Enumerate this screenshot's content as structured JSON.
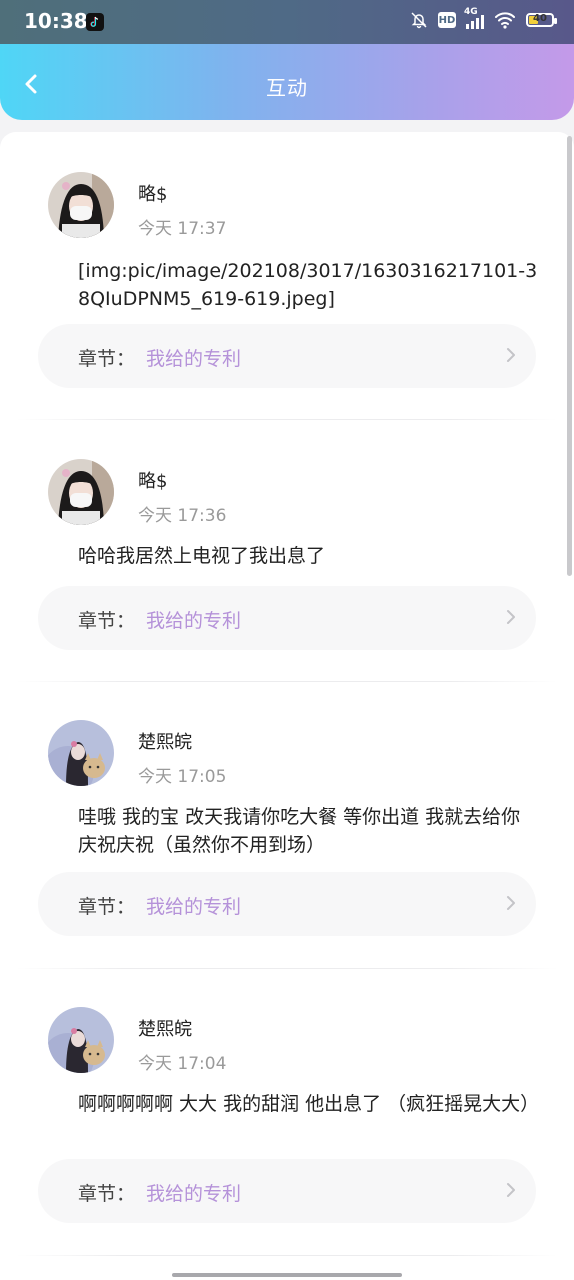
{
  "status_bar": {
    "time": "10:38",
    "network": "4G",
    "hd": "HD",
    "battery": "40",
    "battery_level": 0.4
  },
  "nav": {
    "title": "互动"
  },
  "items": [
    {
      "username": "略$",
      "time": "今天 17:37",
      "comment": "[img:pic/image/202108/3017/1630316217101-38QIuDPNM5_619-619.jpeg]",
      "chapter_label": "章节：",
      "chapter_value": "我给的专利",
      "avatar": "girl-1"
    },
    {
      "username": "略$",
      "time": "今天 17:36",
      "comment": "哈哈我居然上电视了我出息了",
      "chapter_label": "章节：",
      "chapter_value": "我给的专利",
      "avatar": "girl-1"
    },
    {
      "username": "楚熙皖",
      "time": "今天 17:05",
      "comment": "哇哦 我的宝 改天我请你吃大餐 等你出道 我就去给你庆祝庆祝（虽然你不用到场）",
      "chapter_label": "章节：",
      "chapter_value": "我给的专利",
      "avatar": "girl-2"
    },
    {
      "username": "楚熙皖",
      "time": "今天 17:04",
      "comment": "啊啊啊啊啊 大大 我的甜润 他出息了 （疯狂摇晃大大）",
      "chapter_label": "章节：",
      "chapter_value": "我给的专利",
      "avatar": "girl-2"
    }
  ],
  "colors": {
    "accent": "#b592d9",
    "header_start": "#4fd6f6",
    "header_end": "#c49ae9"
  }
}
